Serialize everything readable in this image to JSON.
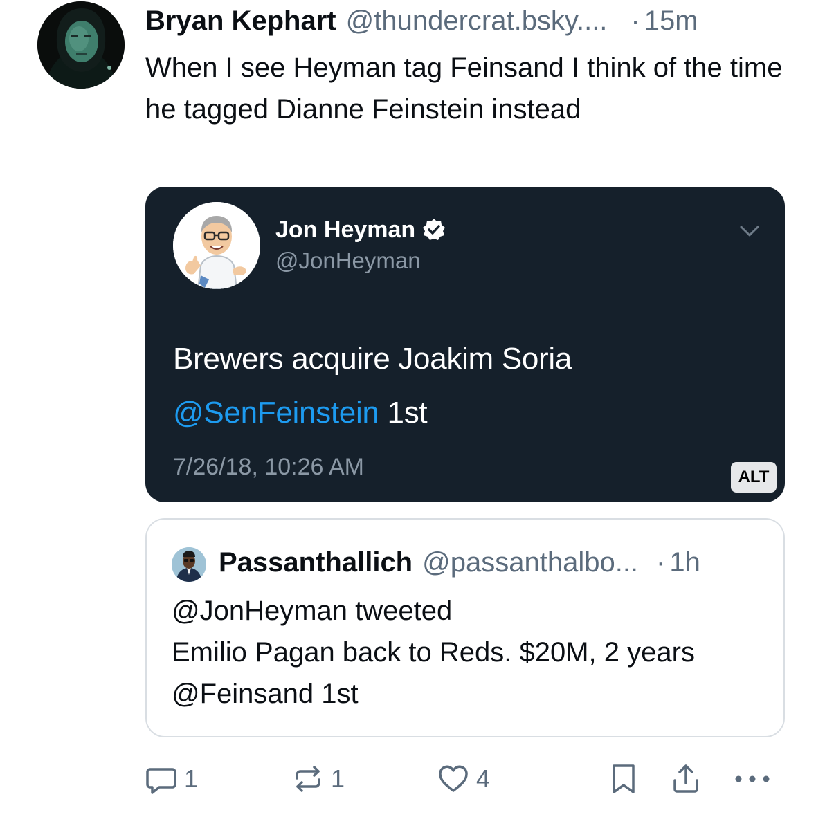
{
  "post": {
    "author_name": "Bryan Kephart",
    "author_handle": "@thundercrat.bsky....",
    "separator": "·",
    "time": "15m",
    "text": "When I see Heyman tag Feinsand I think of the time he tagged Dianne Feinstein instead"
  },
  "embed_image": {
    "name": "Jon Heyman",
    "handle": "@JonHeyman",
    "tweet_line1": "Brewers acquire Joakim Soria",
    "mention": "@SenFeinstein",
    "tweet_suffix": " 1st",
    "date": "7/26/18, 10:26 AM",
    "alt_label": "ALT"
  },
  "quote": {
    "name": "Passanthallich",
    "handle": "@passanthalbo...",
    "separator": "·",
    "time": "1h",
    "text": "@JonHeyman tweeted\nEmilio Pagan back to Reds. $20M, 2 years @Feinsand 1st"
  },
  "actions": {
    "reply_count": "1",
    "repost_count": "1",
    "like_count": "4"
  },
  "icons": {
    "reply": "reply-icon",
    "repost": "repost-icon",
    "like": "heart-icon",
    "bookmark": "bookmark-icon",
    "share": "share-icon",
    "more": "more-icon",
    "verified": "verified-badge-icon",
    "chevron": "chevron-down-icon"
  },
  "colors": {
    "text": "#0b0f14",
    "muted": "#5b6b7c",
    "embed_background": "#15202b",
    "link_blue": "#1d9bf0",
    "border": "#d9dee3"
  }
}
